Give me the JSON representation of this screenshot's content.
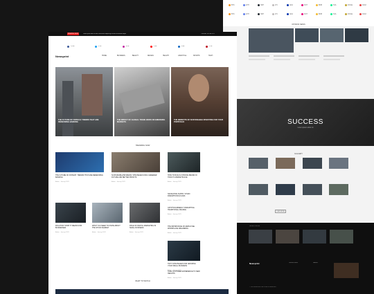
{
  "back_page": {
    "ticker_rows": [
      [
        "BTC",
        "ETH",
        "XRP",
        "LTC",
        "ADA",
        "DOT",
        "BNB",
        "SOL",
        "DOGE",
        "AVAX"
      ],
      [
        "BTC",
        "ETH",
        "XRP",
        "LTC",
        "ADA",
        "DOT",
        "BNB",
        "SOL",
        "DOGE",
        "AVAX"
      ]
    ],
    "section_popular": "OPINION NEWS",
    "success_title": "SUCCESS",
    "success_sub": "Lorem ipsum dolor sit",
    "gallery_label": "GALLERY",
    "load_more": "LOAD MORE",
    "footer_logo": "Newsprint",
    "footer_label_1": "CATEGORIES",
    "footer_label_2": "PAGES",
    "copyright": "© 2023 NEWSPRINT. ALL RIGHTS RESERVED.",
    "dark_band_label": "LATEST NEWS"
  },
  "front_page": {
    "top_bar_badge": "BREAKING NEWS",
    "top_bar_text": "Lorem ipsum dolor sit amet consectetur adipiscing elit sed do eiusmod tempor",
    "top_bar_right": "TUESDAY, 08 FEB 2023",
    "logo": "Newsprint",
    "nav": [
      "HOME",
      "BUSINESS",
      "BEAUTY",
      "DESIGN",
      "HEALTH",
      "LIFESTYLE",
      "SPORTS",
      "TECH"
    ],
    "social_stats": [
      "12.4K",
      "5.1K",
      "8.2K",
      "3.6K",
      "9.4K",
      "1.2K"
    ],
    "hero": [
      {
        "caption": "THE FUTURE OF FINTECH: TRENDS THAT ARE REDEFINING BANKING"
      },
      {
        "caption": "THE IMPACT OF GLOBAL TRADE WARS ON EMERGING MARKETS"
      },
      {
        "caption": "THE BENEFITS OF SUSTAINABLE INVESTING FOR YOUR PORTFOLIO"
      }
    ],
    "trending_label": "TRENDING NOW",
    "cards": [
      {
        "title": "THE FUTURE OF FINTECH: TRENDS THAT ARE REDEFINING BANKING",
        "meta": "Admin  ·  January 2023"
      },
      {
        "title": "SUSTAINABLE BUSINESS: STRATEGIES FOR A GREENER FUTURE AND BETTER PROFITS",
        "meta": "Admin  ·  January 2023"
      },
      {
        "title": "HOW TO BUILD A STRONG BRAND IN TODAY'S MARKETPLACE",
        "meta": "Admin  ·  January 2023"
      },
      {
        "title": "INFLATION: WHAT IT MEANS FOR BUSINESSES",
        "meta": "Admin  ·  January 2023"
      },
      {
        "title": "WHAT YOU NEED TO KNOW ABOUT THE STOCK MARKET",
        "meta": "Admin  ·  January 2023"
      },
      {
        "title": "ROLE OF DIGITAL MARKETING IN SMALL BUSINESS",
        "meta": "Admin  ·  January 2023"
      },
      {
        "title": "NAVIGATING SUPPLY CHAIN DISRUPTIONS IN 2023",
        "meta": "Admin  ·  January 2023"
      },
      {
        "title": "CRYPTOCURRENCY DISRUPTING TRADITIONAL FINANCE",
        "meta": "Admin  ·  January 2023"
      },
      {
        "title": "THE IMPORTANCE OF EMPLOYEE WORKPLACE WELLBEING",
        "meta": "Admin  ·  January 2023"
      },
      {
        "title": "TOP 5 STRATEGIES FOR GROWING YOUR SMALL BUSINESS",
        "meta": "Admin  ·  January 2023"
      },
      {
        "title": "TAKE CUSTOMER EXPERIENCE TO NEW HEIGHTS",
        "meta": "Admin  ·  January 2023"
      }
    ],
    "what_to_watch": "WHAT TO WATCH"
  }
}
